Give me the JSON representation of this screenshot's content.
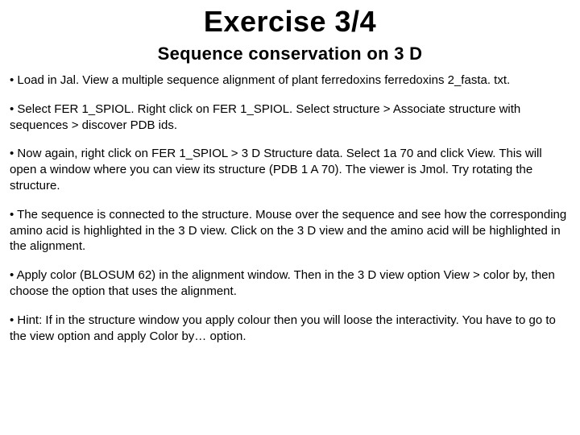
{
  "title": "Exercise 3/4",
  "subtitle": "Sequence conservation on 3 D",
  "bullets": [
    "• Load in Jal. View a multiple sequence alignment of plant ferredoxins ferredoxins 2_fasta. txt.",
    "• Select FER 1_SPIOL. Right click on FER 1_SPIOL. Select structure > Associate structure with sequences > discover PDB ids.",
    "• Now again, right click on FER 1_SPIOL > 3 D Structure data. Select 1a 70 and click View. This will open a window where you can view its structure (PDB 1 A 70). The viewer is Jmol. Try rotating the structure.",
    "• The sequence is connected to the structure. Mouse over the sequence and see how the corresponding amino acid is highlighted in the 3 D view. Click on the 3 D view and the amino acid will be highlighted in the alignment.",
    "• Apply color (BLOSUM 62) in the alignment window. Then in the 3 D view option View > color by, then choose the option that uses the alignment.",
    "• Hint: If in the structure window you apply colour then you will loose the interactivity. You have to go to the view option and apply Color by… option."
  ]
}
